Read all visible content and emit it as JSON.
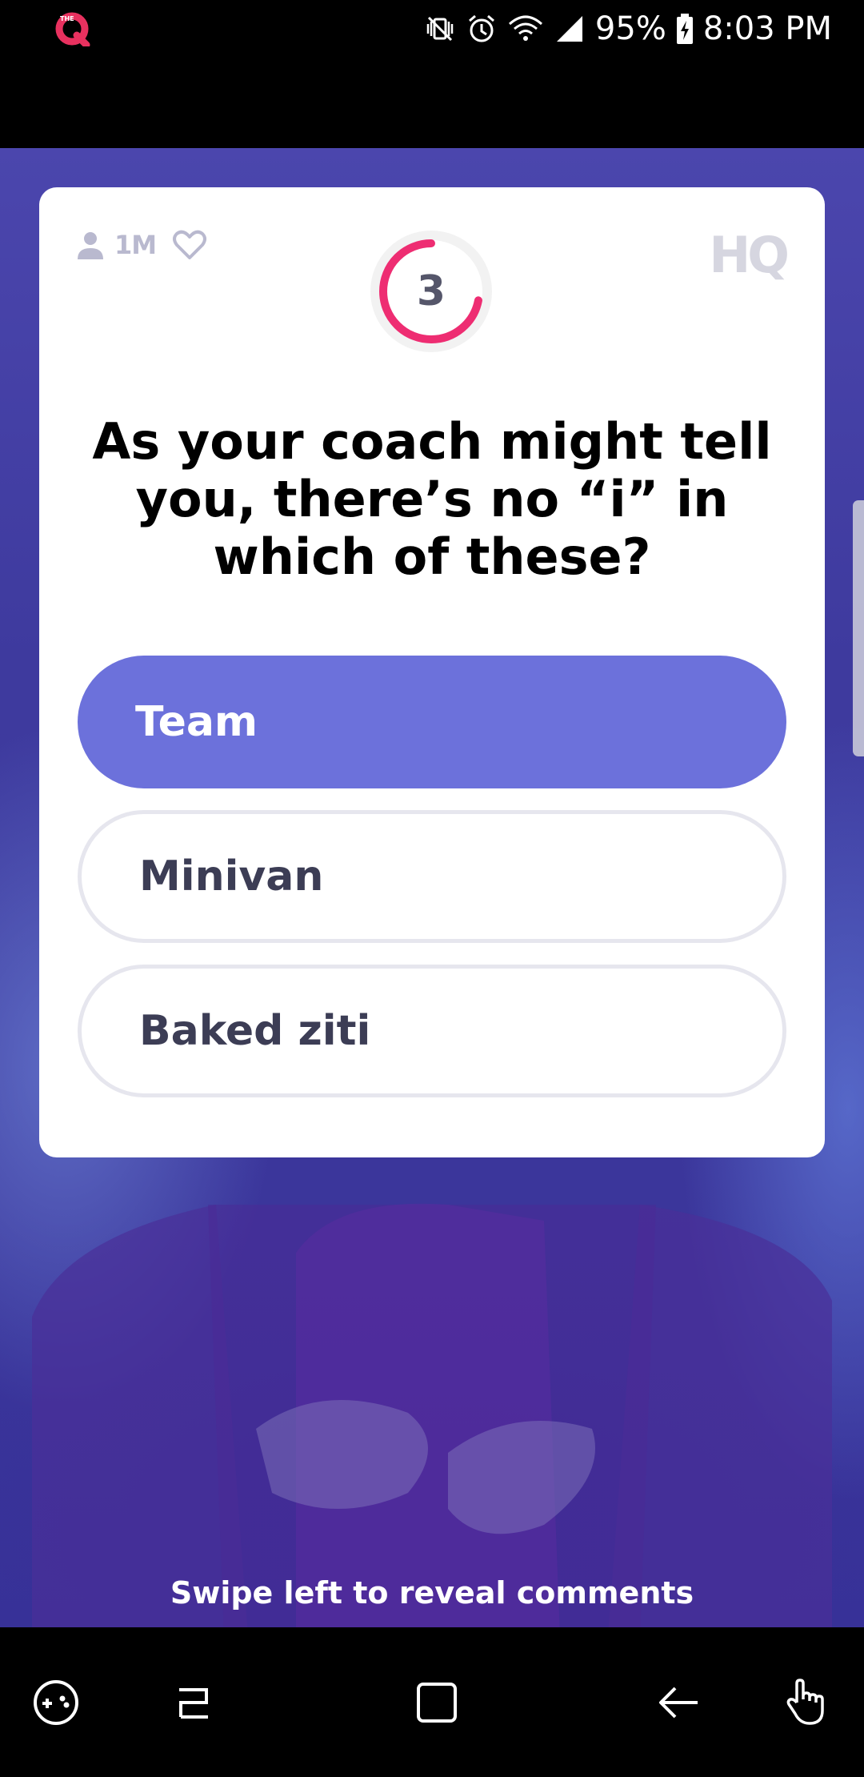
{
  "status_bar": {
    "battery_percent": "95%",
    "time": "8:03 PM",
    "icons": [
      "the-q-app-icon",
      "vibrate-mute-icon",
      "alarm-icon",
      "wifi-icon",
      "signal-icon",
      "battery-charging-icon"
    ]
  },
  "card": {
    "viewer_count": "1M",
    "timer_value": "3",
    "timer_progress": 0.72,
    "brand": "HQ",
    "question": "As your coach might tell you, there’s no “i” in which of these?",
    "answers": [
      {
        "label": "Team",
        "selected": true
      },
      {
        "label": "Minivan",
        "selected": false
      },
      {
        "label": "Baked ziti",
        "selected": false
      }
    ]
  },
  "swipe_hint": "Swipe left to reveal comments",
  "colors": {
    "accent": "#6c71db",
    "timer_ring": "#ee2d72",
    "background": "#3e3a9e"
  },
  "nav_bar": {
    "icons": [
      "game-launcher-icon",
      "recent-apps-icon",
      "home-icon",
      "back-icon",
      "gesture-icon"
    ]
  }
}
